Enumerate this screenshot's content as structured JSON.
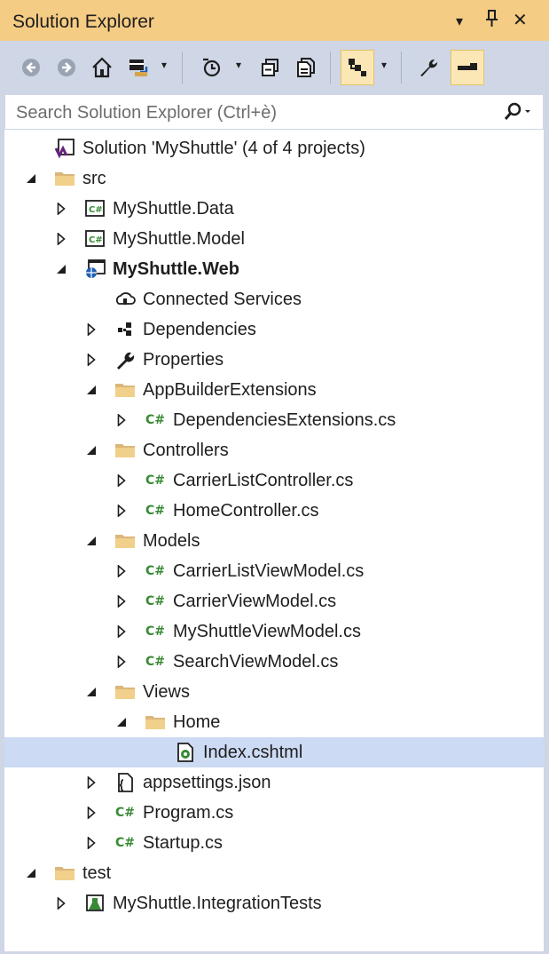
{
  "title": "Solution Explorer",
  "title_controls": {
    "dropdown": "▾",
    "pin": "🖈",
    "close": "✕"
  },
  "search": {
    "placeholder": "Search Solution Explorer (Ctrl+è)"
  },
  "colors": {
    "title_bg": "#f5cc84",
    "toolbar_bg": "#cfd6e5",
    "selected_row": "#ccdaf3",
    "csharp": "#388a34"
  },
  "tree": [
    {
      "label": "Solution 'MyShuttle' (4 of 4 projects)",
      "icon": "solution-icon",
      "depth": 0,
      "expander": "none"
    },
    {
      "label": "src",
      "icon": "folder-icon",
      "depth": 0,
      "expander": "expanded"
    },
    {
      "label": "MyShuttle.Data",
      "icon": "csharp-project-icon",
      "depth": 1,
      "expander": "collapsed"
    },
    {
      "label": "MyShuttle.Model",
      "icon": "csharp-project-icon",
      "depth": 1,
      "expander": "collapsed"
    },
    {
      "label": "MyShuttle.Web",
      "icon": "web-project-icon",
      "depth": 1,
      "expander": "expanded",
      "bold": true
    },
    {
      "label": "Connected Services",
      "icon": "connected-services-icon",
      "depth": 2,
      "expander": "none"
    },
    {
      "label": "Dependencies",
      "icon": "dependencies-icon",
      "depth": 2,
      "expander": "collapsed"
    },
    {
      "label": "Properties",
      "icon": "wrench-icon",
      "depth": 2,
      "expander": "collapsed"
    },
    {
      "label": "AppBuilderExtensions",
      "icon": "folder-icon",
      "depth": 2,
      "expander": "expanded"
    },
    {
      "label": "DependenciesExtensions.cs",
      "icon": "csharp-file-icon",
      "depth": 3,
      "expander": "collapsed"
    },
    {
      "label": "Controllers",
      "icon": "folder-icon",
      "depth": 2,
      "expander": "expanded"
    },
    {
      "label": "CarrierListController.cs",
      "icon": "csharp-file-icon",
      "depth": 3,
      "expander": "collapsed"
    },
    {
      "label": "HomeController.cs",
      "icon": "csharp-file-icon",
      "depth": 3,
      "expander": "collapsed"
    },
    {
      "label": "Models",
      "icon": "folder-icon",
      "depth": 2,
      "expander": "expanded"
    },
    {
      "label": "CarrierListViewModel.cs",
      "icon": "csharp-file-icon",
      "depth": 3,
      "expander": "collapsed"
    },
    {
      "label": "CarrierViewModel.cs",
      "icon": "csharp-file-icon",
      "depth": 3,
      "expander": "collapsed"
    },
    {
      "label": "MyShuttleViewModel.cs",
      "icon": "csharp-file-icon",
      "depth": 3,
      "expander": "collapsed"
    },
    {
      "label": "SearchViewModel.cs",
      "icon": "csharp-file-icon",
      "depth": 3,
      "expander": "collapsed"
    },
    {
      "label": "Views",
      "icon": "folder-icon",
      "depth": 2,
      "expander": "expanded"
    },
    {
      "label": "Home",
      "icon": "folder-icon",
      "depth": 3,
      "expander": "expanded"
    },
    {
      "label": "Index.cshtml",
      "icon": "razor-file-icon",
      "depth": 4,
      "expander": "none",
      "selected": true
    },
    {
      "label": "appsettings.json",
      "icon": "json-file-icon",
      "depth": 2,
      "expander": "collapsed"
    },
    {
      "label": "Program.cs",
      "icon": "csharp-file-icon",
      "depth": 2,
      "expander": "collapsed"
    },
    {
      "label": "Startup.cs",
      "icon": "csharp-file-icon",
      "depth": 2,
      "expander": "collapsed"
    },
    {
      "label": "test",
      "icon": "folder-icon",
      "depth": 0,
      "expander": "expanded"
    },
    {
      "label": "MyShuttle.IntegrationTests",
      "icon": "test-project-icon",
      "depth": 1,
      "expander": "collapsed"
    }
  ]
}
